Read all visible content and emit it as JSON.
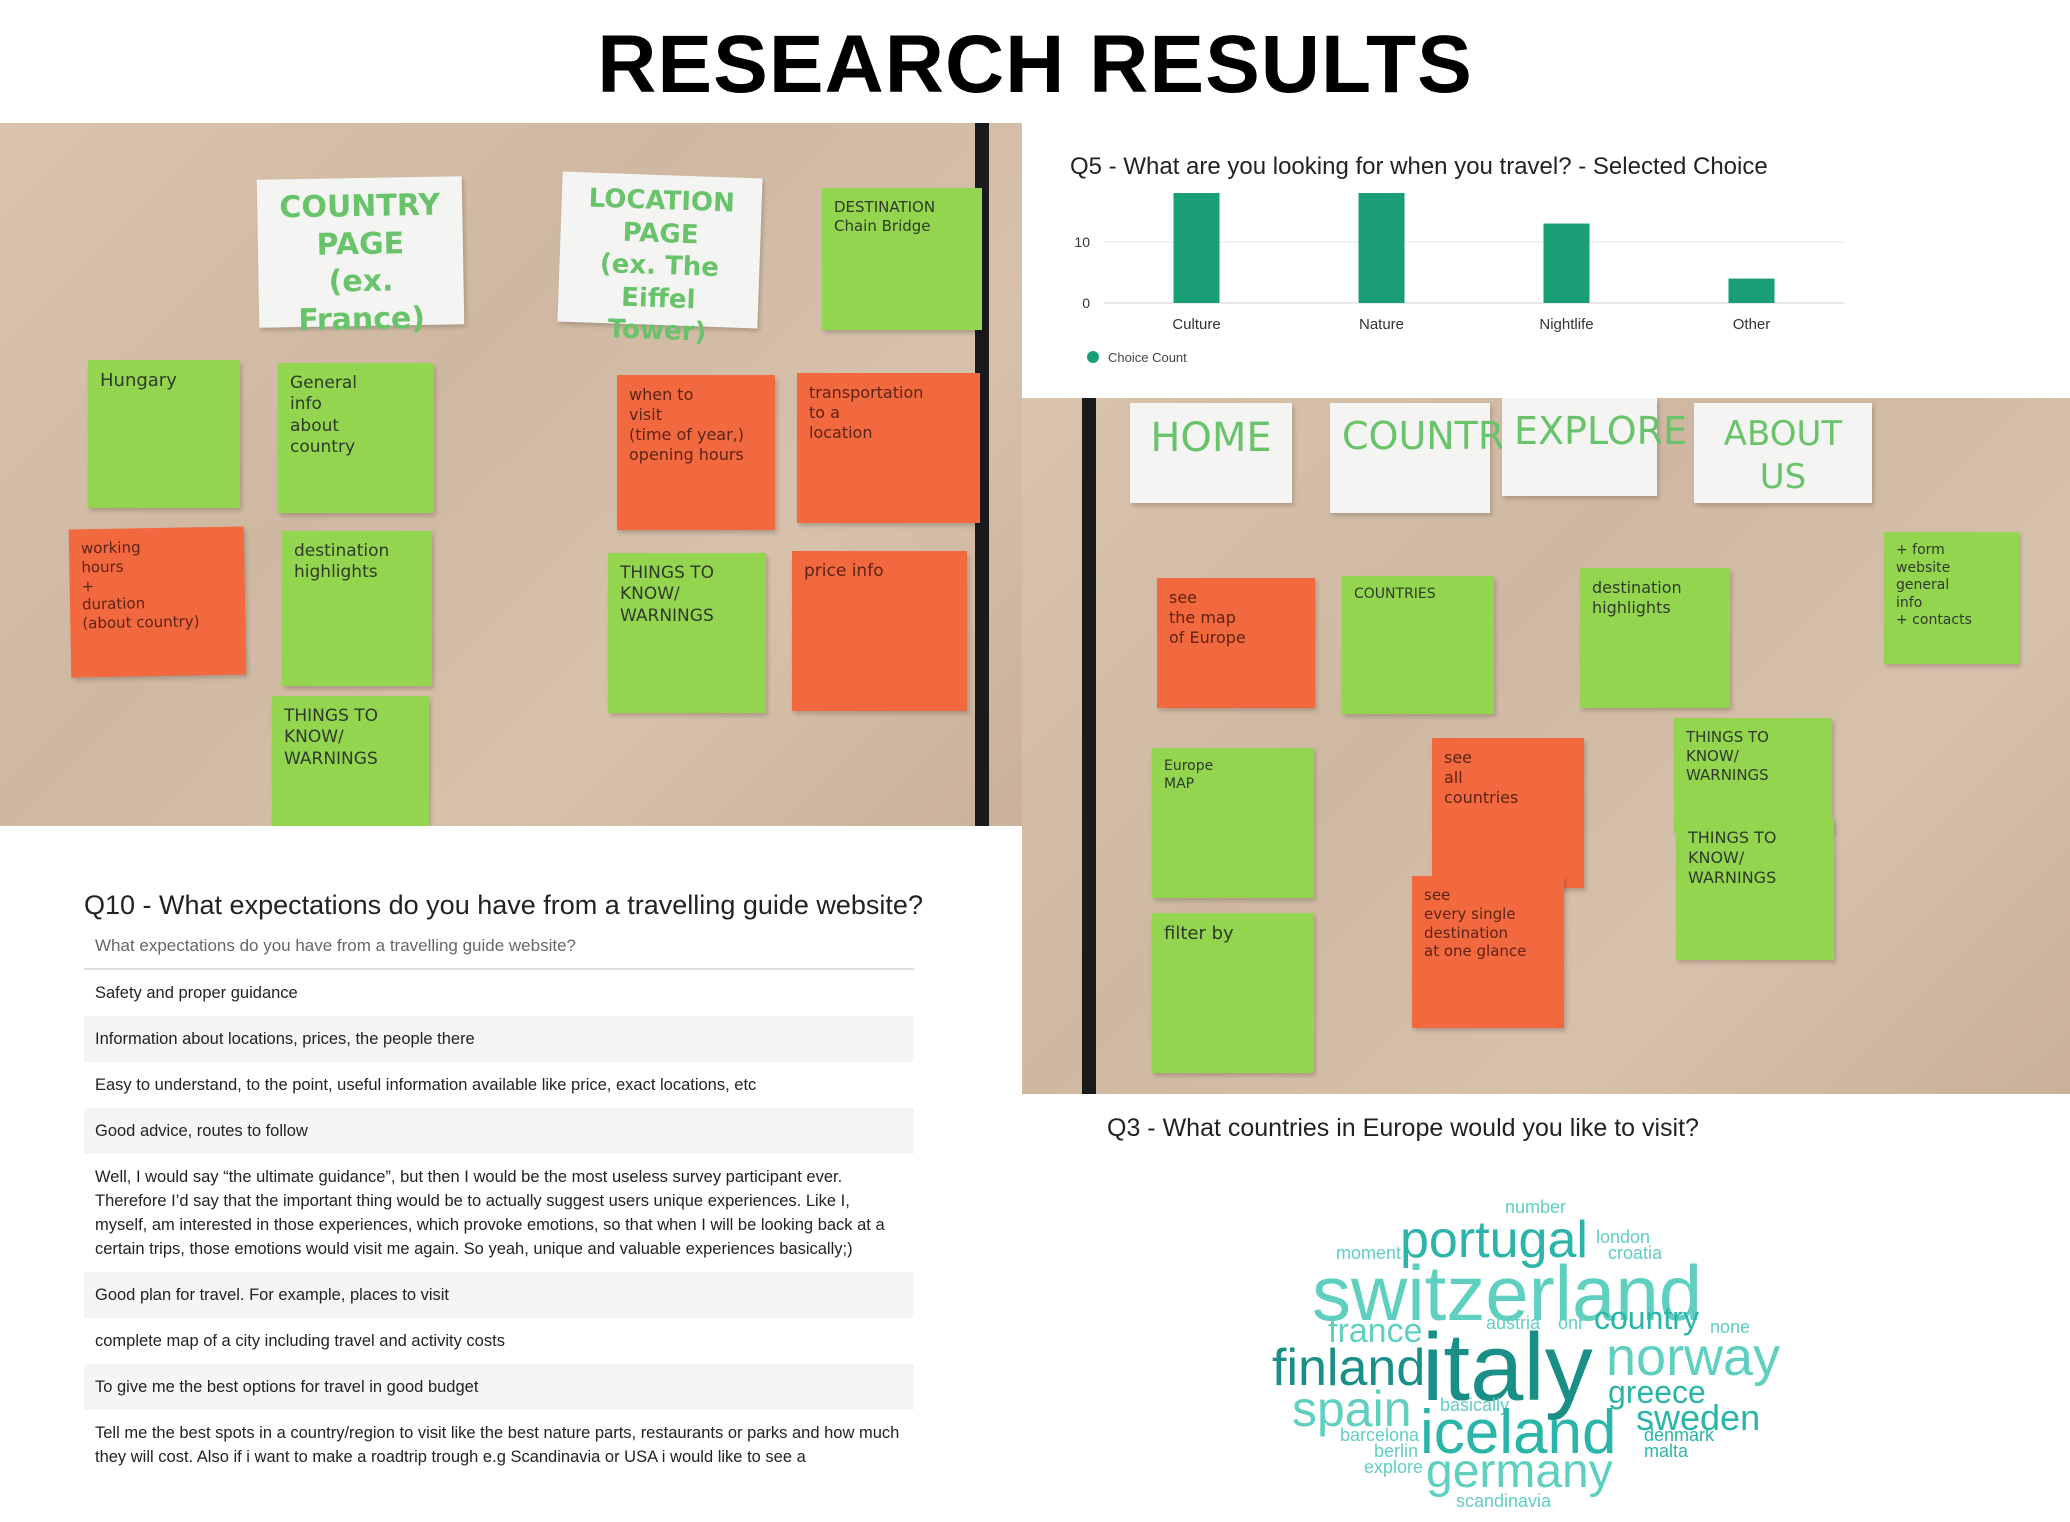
{
  "page": {
    "title": "RESEARCH RESULTS"
  },
  "photo_left": {
    "notes": [
      {
        "id": "country-page",
        "text": "COUNTRY\nPAGE\n(ex. France)"
      },
      {
        "id": "location-page",
        "text": "LOCATION\nPAGE\n(ex. The Eiffel Tower)"
      },
      {
        "id": "destination",
        "text": "DESTINATION\nChain Bridge"
      },
      {
        "id": "hungary",
        "text": "Hungary"
      },
      {
        "id": "general-info",
        "text": "General\ninfo\nabout\ncountry"
      },
      {
        "id": "when-to-visit",
        "text": "when to\nvisit\n(time of year,)\nopening hours"
      },
      {
        "id": "transportation",
        "text": "transportation\nto a\nlocation"
      },
      {
        "id": "working-hours",
        "text": "working\nhours\n+\nduration\n(about country)"
      },
      {
        "id": "destination-highlights",
        "text": "destination\nhighlights"
      },
      {
        "id": "things-to-know-1",
        "text": "THINGS TO\nKNOW/\nWARNINGS"
      },
      {
        "id": "price-info",
        "text": "price info"
      },
      {
        "id": "things-to-know-2",
        "text": "THINGS TO\nKNOW/\nWARNINGS"
      }
    ]
  },
  "photo_right": {
    "notes": [
      {
        "id": "home",
        "text": "HOME"
      },
      {
        "id": "countries",
        "text": "COUNTRIES"
      },
      {
        "id": "explore",
        "text": "EXPLORE"
      },
      {
        "id": "about-us",
        "text": "ABOUT US"
      },
      {
        "id": "see-map",
        "text": "see\nthe map\nof Europe"
      },
      {
        "id": "countries-grid",
        "text": "COUNTRIES"
      },
      {
        "id": "destination-highlights-2",
        "text": "destination\nhighlights"
      },
      {
        "id": "form",
        "text": "+ form\nwebsite\ngeneral\ninfo\n+ contacts"
      },
      {
        "id": "europe-map",
        "text": "Europe\nMAP"
      },
      {
        "id": "see-all",
        "text": "see\nall\ncountries"
      },
      {
        "id": "things-to-know-3",
        "text": "THINGS TO\nKNOW/\nWARNINGS"
      },
      {
        "id": "things-to-know-4",
        "text": "THINGS TO\nKNOW/\nWARNINGS"
      },
      {
        "id": "see-every",
        "text": "see\nevery single\ndestination\nat one glance"
      },
      {
        "id": "filter-by",
        "text": "filter by"
      }
    ]
  },
  "chart_data": {
    "type": "bar",
    "title": "Q5 - What are you looking for when you travel? - Selected Choice",
    "categories": [
      "Culture",
      "Nature",
      "Nightlife",
      "Other"
    ],
    "series": [
      {
        "name": "Choice Count",
        "values": [
          18,
          18,
          13,
          4
        ]
      }
    ],
    "ylim": [
      0,
      18
    ],
    "yticks": [
      0,
      10
    ],
    "color": "#1a9e76",
    "grid": true,
    "legend": "bottom-left"
  },
  "q10": {
    "title": "Q10 - What expectations do you have from a travelling guide website?",
    "header": "What expectations do you have from a travelling guide website?",
    "rows": [
      "Safety and proper guidance",
      "Information about locations, prices, the people there",
      "Easy to understand, to the point, useful information available like price, exact locations, etc",
      "Good advice, routes to follow",
      "Well, I would say “the ultimate guidance”, but then I would be the most useless survey participant ever. Therefore I’d say that the important thing would be to actually suggest users unique experiences. Like I, myself, am interested in those experiences, which provoke emotions, so that when I will be looking back at a certain trips, those emotions would visit me again. So yeah, unique and valuable experiences basically;)",
      "Good plan for travel. For example, places to visit",
      "complete map of a city including travel and activity costs",
      "To give me the best options for travel in good budget",
      "Tell me the best spots in a country/region to visit like the best nature parts, restaurants or parks and how much they will cost. Also if i want to make a roadtrip trough e.g Scandinavia or USA i would like to see a"
    ]
  },
  "q3": {
    "title": "Q3 - What countries in Europe would you like to visit?",
    "colors": {
      "light": "#5fcfc0",
      "mid": "#2bb5a8",
      "dark": "#1a8f87"
    },
    "words": [
      {
        "text": "number"
      },
      {
        "text": "portugal"
      },
      {
        "text": "london"
      },
      {
        "text": "moment"
      },
      {
        "text": "croatia"
      },
      {
        "text": "switzerland"
      },
      {
        "text": "france"
      },
      {
        "text": "austria"
      },
      {
        "text": "onr"
      },
      {
        "text": "country"
      },
      {
        "text": "none"
      },
      {
        "text": "finland"
      },
      {
        "text": "italy"
      },
      {
        "text": "norway"
      },
      {
        "text": "greece"
      },
      {
        "text": "spain"
      },
      {
        "text": "basically"
      },
      {
        "text": "sweden"
      },
      {
        "text": "barcelona"
      },
      {
        "text": "iceland"
      },
      {
        "text": "denmark"
      },
      {
        "text": "berlin"
      },
      {
        "text": "malta"
      },
      {
        "text": "explore"
      },
      {
        "text": "germany"
      },
      {
        "text": "scandinavia"
      }
    ]
  }
}
